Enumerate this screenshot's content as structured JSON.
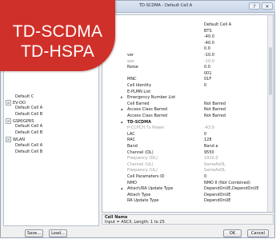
{
  "window": {
    "title": "TD-SCDMA - Default Cell A",
    "controls": [
      "?",
      "✕"
    ]
  },
  "badge": {
    "line1": "TD-SCDMA",
    "line2": "TD-HSPA",
    "color": "#d0302a"
  },
  "tree": {
    "items": [
      {
        "label": "Default C",
        "expander": "",
        "indent": 2
      },
      {
        "label": "EV-DO",
        "expander": "⊟",
        "indent": 0
      },
      {
        "label": "Default Cell A",
        "expander": "",
        "indent": 2
      },
      {
        "label": "Default Cell B",
        "expander": "",
        "indent": 2
      },
      {
        "label": "GSM/GPRS",
        "expander": "⊟",
        "indent": 0
      },
      {
        "label": "Default Cell A",
        "expander": "",
        "indent": 2
      },
      {
        "label": "Default Cell B",
        "expander": "",
        "indent": 2
      },
      {
        "label": "WLAN",
        "expander": "⊟",
        "indent": 0
      },
      {
        "label": "Default Cell A",
        "expander": "",
        "indent": 2
      },
      {
        "label": "Default Cell B",
        "expander": "",
        "indent": 2
      }
    ]
  },
  "grid": {
    "rows": [
      {
        "name": "",
        "value": "Default Cell A",
        "grey": false,
        "group": false,
        "expander": ""
      },
      {
        "name": "",
        "value": "BTS",
        "grey": false,
        "group": false,
        "expander": ""
      },
      {
        "name": "",
        "value": "-40.0",
        "grey": false,
        "group": false,
        "expander": ""
      },
      {
        "name": "",
        "value": "-40.0",
        "grey": false,
        "group": false,
        "expander": ""
      },
      {
        "name": "",
        "value": "0.0",
        "grey": false,
        "group": false,
        "expander": ""
      },
      {
        "name": "ver",
        "value": "-10.0",
        "grey": false,
        "group": false,
        "expander": ""
      },
      {
        "name": "wer",
        "value": "-10.0",
        "grey": true,
        "group": false,
        "expander": ""
      },
      {
        "name": "Noise",
        "value": "0.0",
        "grey": false,
        "group": false,
        "expander": ""
      },
      {
        "name": "",
        "value": "001",
        "grey": false,
        "group": false,
        "expander": ""
      },
      {
        "name": "MNC",
        "value": "01F",
        "grey": false,
        "group": false,
        "expander": ""
      },
      {
        "name": "Cell Identity",
        "value": "0",
        "grey": false,
        "group": false,
        "expander": ""
      },
      {
        "name": "E-PLMN List",
        "value": "",
        "grey": false,
        "group": false,
        "expander": ""
      },
      {
        "name": "Emergency Number List",
        "value": "",
        "grey": false,
        "group": false,
        "expander": "▸"
      },
      {
        "name": "Cell Barred",
        "value": "Not Barred",
        "grey": false,
        "group": false,
        "expander": ""
      },
      {
        "name": "Access Class Barred",
        "value": "Not Barred",
        "grey": false,
        "group": false,
        "expander": "▴"
      },
      {
        "name": "   Access Class Barred",
        "value": "Not Barred",
        "grey": false,
        "group": false,
        "expander": ""
      },
      {
        "name": "TD-SCDMA",
        "value": "",
        "grey": false,
        "group": true,
        "expander": "▴"
      },
      {
        "name": "P-CCPCH Tx Power",
        "value": "-43.0",
        "grey": true,
        "group": false,
        "expander": ""
      },
      {
        "name": "LAC",
        "value": "0",
        "grey": false,
        "group": false,
        "expander": ""
      },
      {
        "name": "RAC",
        "value": "128",
        "grey": false,
        "group": false,
        "expander": ""
      },
      {
        "name": "Band",
        "value": "Band a",
        "grey": false,
        "group": false,
        "expander": ""
      },
      {
        "name": "Channel (DL)",
        "value": "9550",
        "grey": false,
        "group": false,
        "expander": ""
      },
      {
        "name": "Frequency (DL)",
        "value": "1910.0",
        "grey": true,
        "group": false,
        "expander": ""
      },
      {
        "name": "Channel (UL)",
        "value": "SameAsDL",
        "grey": true,
        "group": false,
        "expander": ""
      },
      {
        "name": "Frequency (UL)",
        "value": "SameAsDL",
        "grey": true,
        "group": false,
        "expander": ""
      },
      {
        "name": "Cell Parameters ID",
        "value": "0",
        "grey": false,
        "group": false,
        "expander": ""
      },
      {
        "name": "NMO",
        "value": "NMO II (Not Combined)",
        "grey": false,
        "group": false,
        "expander": ""
      },
      {
        "name": "Attach/RA Update Type",
        "value": "DependOnUE,DependOnUE",
        "grey": false,
        "group": false,
        "expander": "▴"
      },
      {
        "name": "   Attach Type",
        "value": "DependOnUE",
        "grey": false,
        "group": false,
        "expander": ""
      },
      {
        "name": "   RA Update Type",
        "value": "DependOnUE",
        "grey": false,
        "group": false,
        "expander": ""
      }
    ]
  },
  "description": {
    "title": "Cell Name",
    "text": "Input = ASCII, Length: 1 to 25"
  },
  "buttons": {
    "save": "Save...",
    "load": "Load...",
    "ok": "OK",
    "cancel": "Cancel"
  }
}
